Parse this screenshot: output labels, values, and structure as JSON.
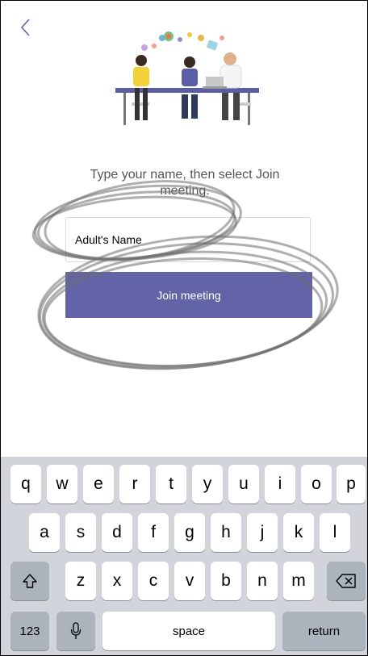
{
  "header": {
    "back_icon": "chevron-left-icon"
  },
  "illustration": {
    "icon": "meeting-people-illustration"
  },
  "prompt": {
    "line1": "Type your name, then select Join",
    "line2": "meeting."
  },
  "name_input": {
    "value": "Adult's Name"
  },
  "join_button": {
    "label": "Join meeting"
  },
  "colors": {
    "accent": "#6264a7",
    "keyboard_bg": "#d1d4da",
    "key_bg": "#ffffff",
    "key_dark_bg": "#adb3bc"
  },
  "keyboard": {
    "row1": [
      "q",
      "w",
      "e",
      "r",
      "t",
      "y",
      "u",
      "i",
      "o",
      "p"
    ],
    "row2": [
      "a",
      "s",
      "d",
      "f",
      "g",
      "h",
      "j",
      "k",
      "l"
    ],
    "row3": [
      "z",
      "x",
      "c",
      "v",
      "b",
      "n",
      "m"
    ],
    "shift_icon": "shift-icon",
    "delete_icon": "backspace-icon",
    "numbers_label": "123",
    "mic_icon": "microphone-icon",
    "space_label": "space",
    "return_label": "return"
  }
}
